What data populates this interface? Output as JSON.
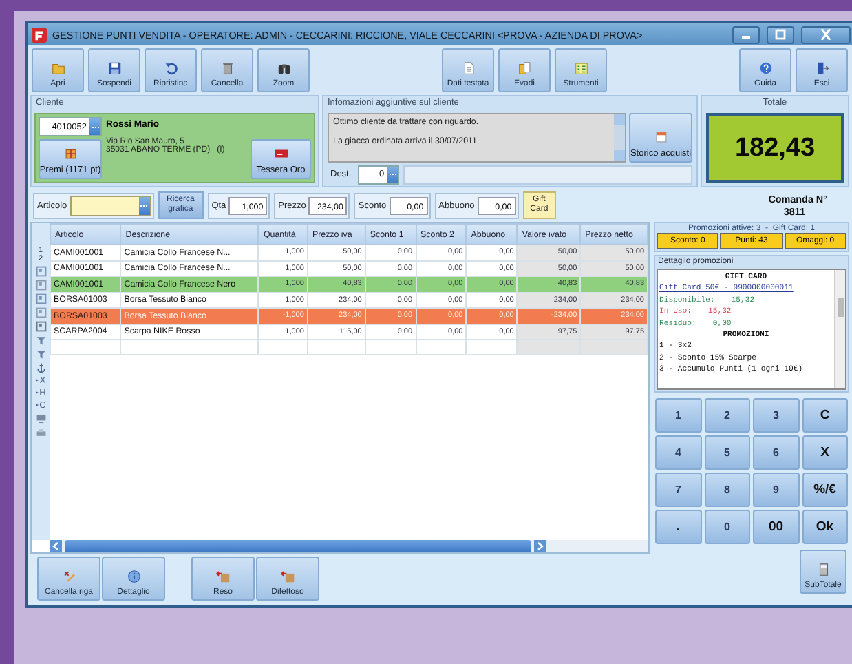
{
  "window": {
    "title": "GESTIONE PUNTI VENDITA - OPERATORE: ADMIN - CECCARINI: RICCIONE, VIALE CECCARINI <PROVA - AZIENDA DI PROVA>"
  },
  "toolbar": {
    "left": [
      "Apri",
      "Sospendi",
      "Ripristina",
      "Cancella",
      "Zoom"
    ],
    "center": [
      "Dati testata",
      "Evadi",
      "Strumenti"
    ],
    "right": [
      "Guida",
      "Esci"
    ]
  },
  "cliente": {
    "heading": "Cliente",
    "code": "4010052",
    "name": "Rossi Mario",
    "address": [
      "Via Rio San Mauro, 5",
      "35031 ABANO TERME (PD)   (I)"
    ],
    "premi_button": "Premi (1171 pt)",
    "card_button": "Tessera Oro"
  },
  "info": {
    "heading": "Infomazioni aggiuntive sul cliente",
    "notes": [
      "Ottimo cliente da trattare con riguardo.",
      "La giacca ordinata arriva il 30/07/2011"
    ],
    "history_button": "Storico acquisti",
    "dest_label": "Dest.",
    "dest_value": "0"
  },
  "totale": {
    "heading": "Totale",
    "value": "182,43"
  },
  "entry": {
    "article_label": "Articolo",
    "search_button": "Ricerca grafica",
    "fields": [
      {
        "label": "Qta",
        "value": "1,000"
      },
      {
        "label": "Prezzo",
        "value": "234,00"
      },
      {
        "label": "Sconto",
        "value": "0,00"
      },
      {
        "label": "Abbuono",
        "value": "0,00"
      }
    ],
    "gift_button": "Gift Card"
  },
  "order": {
    "label": "Comanda N°",
    "number": "3811"
  },
  "side": {
    "numbers": [
      "1",
      "2"
    ],
    "filters": [
      "X",
      "H",
      "C"
    ]
  },
  "table": {
    "columns": [
      "Articolo",
      "Descrizione",
      "Quantità",
      "Prezzo iva",
      "Sconto 1",
      "Sconto 2",
      "Abbuono",
      "Valore ivato",
      "Prezzo netto"
    ],
    "rows": [
      {
        "kind": "normal",
        "cells": [
          "CAMI001001",
          "Camicia Collo Francese N...",
          "1,000",
          "50,00",
          "0,00",
          "0,00",
          "0,00",
          "50,00",
          "50,00"
        ]
      },
      {
        "kind": "normal",
        "cells": [
          "CAMI001001",
          "Camicia Collo Francese N...",
          "1,000",
          "50,00",
          "0,00",
          "0,00",
          "0,00",
          "50,00",
          "50,00"
        ]
      },
      {
        "kind": "promo",
        "cells": [
          "CAMI001001",
          "Camicia Collo Francese Nero",
          "1,000",
          "40,83",
          "0,00",
          "0,00",
          "0,00",
          "40,83",
          "40,83"
        ]
      },
      {
        "kind": "normal",
        "cells": [
          "BORSA01003",
          "Borsa Tessuto Bianco",
          "1,000",
          "234,00",
          "0,00",
          "0,00",
          "0,00",
          "234,00",
          "234,00"
        ]
      },
      {
        "kind": "return",
        "cells": [
          "BORSA01003",
          "Borsa Tessuto Bianco",
          "-1,000",
          "234,00",
          "0,00",
          "0,00",
          "0,00",
          "-234,00",
          "234,00"
        ]
      },
      {
        "kind": "normal",
        "cells": [
          "SCARPA2004",
          "Scarpa NIKE Rosso",
          "1,000",
          "115,00",
          "0,00",
          "0,00",
          "0,00",
          "97,75",
          "97,75"
        ]
      }
    ]
  },
  "row_buttons": [
    [
      "Cancella riga",
      "Dettaglio"
    ],
    [
      "Reso",
      "Difettoso"
    ]
  ],
  "promo": {
    "summary": "Promozioni attive: 3  -  Gift Card: 1",
    "badges": [
      "Sconto: 0",
      "Punti: 43",
      "Omaggi: 0"
    ]
  },
  "details": {
    "heading": "Dettaglio promozioni",
    "lines": [
      {
        "kind": "title",
        "text": "GIFT CARD"
      },
      {
        "kind": "link",
        "text": "Gift Card 50€ - 9900000000011"
      },
      {
        "kind": "value",
        "label": "Disponibile:",
        "value": "15,32",
        "color": "#2e8b57"
      },
      {
        "kind": "value",
        "label": "In Uso:",
        "value": "15,32",
        "color": "#e0405a"
      },
      {
        "kind": "value",
        "label": "Residuo:",
        "value": "0,00",
        "color": "#2e8b57"
      },
      {
        "kind": "title",
        "text": "PROMOZIONI"
      },
      {
        "kind": "plain",
        "text": "1 - 3x2"
      },
      {
        "kind": "plain",
        "text": "2 - Sconto 15% Scarpe"
      },
      {
        "kind": "plain",
        "text": "3 - Accumulo Punti (1 ogni 10€)"
      }
    ]
  },
  "keypad": [
    "1",
    "2",
    "3",
    "C",
    "4",
    "5",
    "6",
    "X",
    "7",
    "8",
    "9",
    "%/€",
    ".",
    "0",
    "00",
    "Ok"
  ],
  "subtotal_button": "SubTotale"
}
